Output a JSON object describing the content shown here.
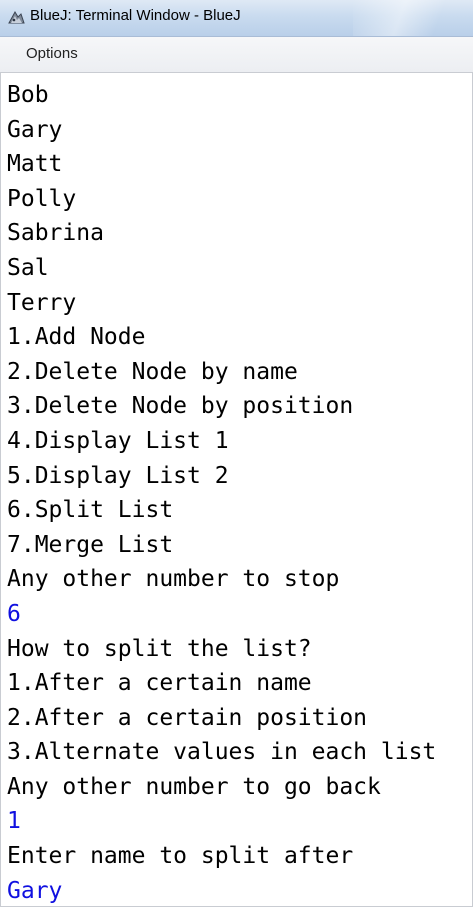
{
  "window": {
    "title": "BlueJ: Terminal Window - BlueJ",
    "icon": "bluej-app-icon"
  },
  "menu": {
    "options_label": "Options"
  },
  "colors": {
    "output_text": "#000000",
    "input_text": "#1010e0"
  },
  "terminal": {
    "lines": [
      {
        "text": "Bob",
        "kind": "output"
      },
      {
        "text": "Gary",
        "kind": "output"
      },
      {
        "text": "Matt",
        "kind": "output"
      },
      {
        "text": "Polly",
        "kind": "output"
      },
      {
        "text": "Sabrina",
        "kind": "output"
      },
      {
        "text": "Sal",
        "kind": "output"
      },
      {
        "text": "Terry",
        "kind": "output"
      },
      {
        "text": "1.Add Node",
        "kind": "output"
      },
      {
        "text": "2.Delete Node by name",
        "kind": "output"
      },
      {
        "text": "3.Delete Node by position",
        "kind": "output"
      },
      {
        "text": "4.Display List 1",
        "kind": "output"
      },
      {
        "text": "5.Display List 2",
        "kind": "output"
      },
      {
        "text": "6.Split List",
        "kind": "output"
      },
      {
        "text": "7.Merge List",
        "kind": "output"
      },
      {
        "text": "Any other number to stop",
        "kind": "output"
      },
      {
        "text": "6",
        "kind": "input"
      },
      {
        "text": "How to split the list?",
        "kind": "output"
      },
      {
        "text": "1.After a certain name",
        "kind": "output"
      },
      {
        "text": "2.After a certain position",
        "kind": "output"
      },
      {
        "text": "3.Alternate values in each list",
        "kind": "output"
      },
      {
        "text": "Any other number to go back",
        "kind": "output"
      },
      {
        "text": "1",
        "kind": "input"
      },
      {
        "text": "Enter name to split after",
        "kind": "output"
      },
      {
        "text": "Gary",
        "kind": "input"
      }
    ]
  }
}
